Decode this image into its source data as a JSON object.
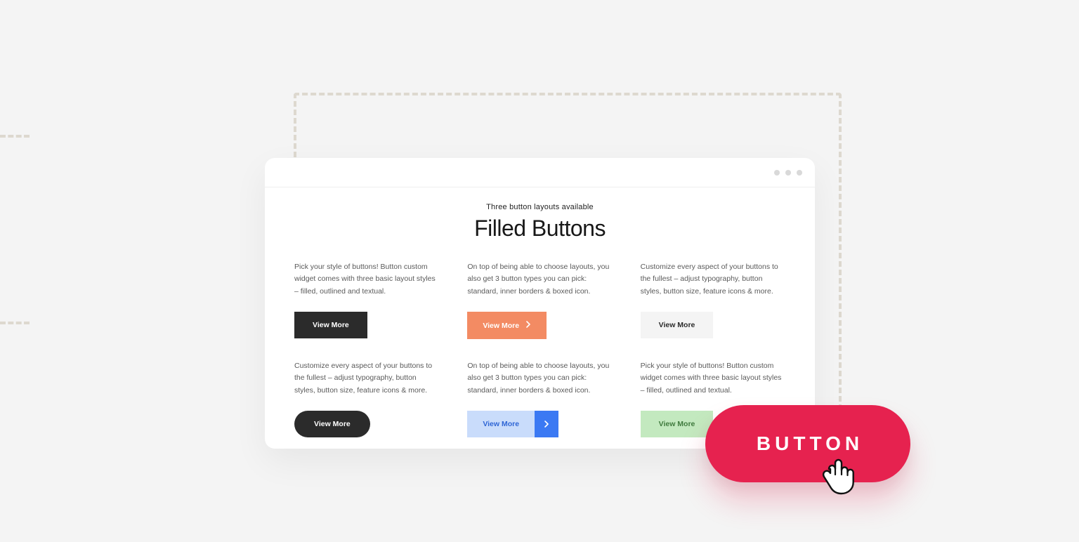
{
  "header": {
    "subtitle": "Three button layouts available",
    "title": "Filled Buttons"
  },
  "cards": [
    {
      "text": "Pick your style of buttons! Button custom widget comes with three basic layout styles – filled, outlined and textual.",
      "button_label": "View More"
    },
    {
      "text": "On top of being able to choose layouts, you also get 3 button types you can pick: standard, inner borders & boxed icon.",
      "button_label": "View More"
    },
    {
      "text": "Customize every aspect of your buttons to the fullest – adjust typography, button styles, button size, feature icons & more.",
      "button_label": "View More"
    },
    {
      "text": "Customize every aspect of your buttons to the fullest – adjust typography, button styles, button size, feature icons & more.",
      "button_label": "View More"
    },
    {
      "text": "On top of being able to choose layouts, you also get 3 button types you can pick: standard, inner borders & boxed icon.",
      "button_label": "View More"
    },
    {
      "text": "Pick your style of buttons! Button custom widget comes with three basic layout styles – filled, outlined and textual.",
      "button_label": "View More"
    }
  ],
  "cta": {
    "label": "BUTTON"
  }
}
